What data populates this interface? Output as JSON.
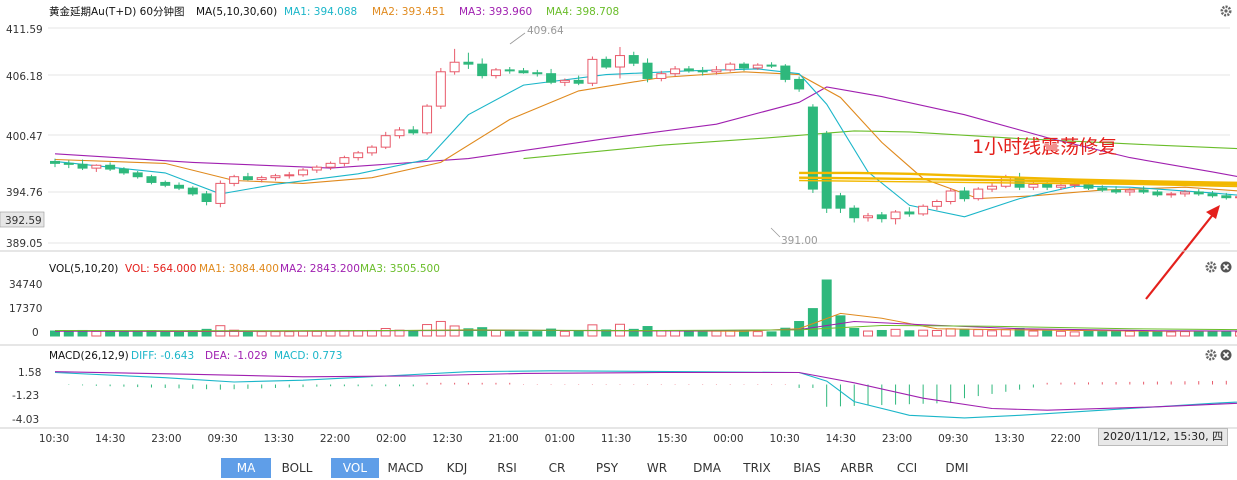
{
  "colors": {
    "up": "#e85a6a",
    "down": "#2eb87c",
    "ma1": "#1bb6c9",
    "ma2": "#e08a1e",
    "ma3": "#a020b0",
    "ma4": "#6abd2a",
    "annot": "#e4201c",
    "yellow": "#f2b800"
  },
  "main_panel": {
    "title": "黄金延期Au(T+D) 60分钟图",
    "ma_label": "MA(5,10,30,60)",
    "ma1_label": "MA1: 394.088",
    "ma2_label": "MA2: 393.451",
    "ma3_label": "MA3: 393.960",
    "ma4_label": "MA4: 398.708",
    "y_ticks": [
      "411.59",
      "406.18",
      "400.47",
      "394.76",
      "389.05"
    ],
    "current_price": "392.59",
    "high_label": "409.64",
    "low_label": "391.00",
    "annotation": "1小时线震荡修复"
  },
  "vol_panel": {
    "label": "VOL(5,10,20)",
    "vol_label": "VOL: 564.000",
    "ma1_label": "MA1: 3084.400",
    "ma2_label": "MA2: 2843.200",
    "ma3_label": "MA3: 3505.500",
    "y_ticks": [
      "34740",
      "17370",
      "0"
    ]
  },
  "macd_panel": {
    "label": "MACD(26,12,9)",
    "diff_label": "DIFF: -0.643",
    "dea_label": "DEA: -1.029",
    "macd_label": "MACD: 0.773",
    "y_ticks": [
      "1.58",
      "-1.23",
      "-4.03"
    ]
  },
  "x_ticks": [
    "10:30",
    "14:30",
    "23:00",
    "09:30",
    "13:30",
    "22:00",
    "02:00",
    "12:30",
    "21:00",
    "01:00",
    "11:30",
    "15:30",
    "00:00",
    "10:30",
    "14:30",
    "23:00",
    "09:30",
    "13:30",
    "22:00"
  ],
  "crosshair_time": "2020/11/12, 15:30, 四",
  "tabs": [
    "MA",
    "BOLL",
    "VOL",
    "MACD",
    "KDJ",
    "RSI",
    "CR",
    "PSY",
    "WR",
    "DMA",
    "TRIX",
    "BIAS",
    "ARBR",
    "CCI",
    "DMI"
  ],
  "active_tabs": [
    "MA",
    "VOL"
  ],
  "icons": {
    "settings": "gear-icon",
    "close": "close-icon"
  },
  "chart_data": {
    "type": "candlestick",
    "title": "黄金延期Au(T+D) 60分钟图",
    "ylim": [
      389.05,
      411.59
    ],
    "candles": [
      [
        397.6,
        397.9,
        397.0,
        397.4
      ],
      [
        397.4,
        397.7,
        396.9,
        397.3
      ],
      [
        397.3,
        397.8,
        396.7,
        396.9
      ],
      [
        396.9,
        397.3,
        396.5,
        397.2
      ],
      [
        397.2,
        397.5,
        396.6,
        396.8
      ],
      [
        396.8,
        397.0,
        396.2,
        396.4
      ],
      [
        396.4,
        396.6,
        395.8,
        396.0
      ],
      [
        396.0,
        396.2,
        395.2,
        395.4
      ],
      [
        395.4,
        395.6,
        394.9,
        395.1
      ],
      [
        395.1,
        395.4,
        394.6,
        394.8
      ],
      [
        394.8,
        395.0,
        394.0,
        394.2
      ],
      [
        394.2,
        394.5,
        393.0,
        393.4
      ],
      [
        393.2,
        395.6,
        392.8,
        395.3
      ],
      [
        395.3,
        396.2,
        395.0,
        396.0
      ],
      [
        396.0,
        396.4,
        395.6,
        395.7
      ],
      [
        395.7,
        396.1,
        395.4,
        395.9
      ],
      [
        395.9,
        396.3,
        395.6,
        396.1
      ],
      [
        396.1,
        396.5,
        395.8,
        396.2
      ],
      [
        396.2,
        396.9,
        396.0,
        396.7
      ],
      [
        396.7,
        397.2,
        396.4,
        397.0
      ],
      [
        397.0,
        397.6,
        396.7,
        397.4
      ],
      [
        397.4,
        398.2,
        397.1,
        398.0
      ],
      [
        398.0,
        398.7,
        397.7,
        398.5
      ],
      [
        398.5,
        399.3,
        398.2,
        399.1
      ],
      [
        399.1,
        400.7,
        398.9,
        400.3
      ],
      [
        400.3,
        401.2,
        400.0,
        400.9
      ],
      [
        400.9,
        401.3,
        400.4,
        400.6
      ],
      [
        400.6,
        403.6,
        400.4,
        403.4
      ],
      [
        403.4,
        407.4,
        403.1,
        407.0
      ],
      [
        407.0,
        409.4,
        406.7,
        408.0
      ],
      [
        408.0,
        409.0,
        407.3,
        407.8
      ],
      [
        407.8,
        408.4,
        406.3,
        406.6
      ],
      [
        406.6,
        407.4,
        406.3,
        407.2
      ],
      [
        407.2,
        407.5,
        406.8,
        407.1
      ],
      [
        407.1,
        407.4,
        406.8,
        406.9
      ],
      [
        406.9,
        407.2,
        406.5,
        406.8
      ],
      [
        406.8,
        407.3,
        405.7,
        405.9
      ],
      [
        405.9,
        406.3,
        405.5,
        406.1
      ],
      [
        406.1,
        406.6,
        405.6,
        405.8
      ],
      [
        405.8,
        408.6,
        405.5,
        408.3
      ],
      [
        408.3,
        408.6,
        407.3,
        407.5
      ],
      [
        407.5,
        409.6,
        406.3,
        408.7
      ],
      [
        408.7,
        409.1,
        407.6,
        407.9
      ],
      [
        407.9,
        408.4,
        405.9,
        406.3
      ],
      [
        406.3,
        407.1,
        406.0,
        406.8
      ],
      [
        406.8,
        407.6,
        406.5,
        407.3
      ],
      [
        407.3,
        407.6,
        406.9,
        407.1
      ],
      [
        407.1,
        407.5,
        406.6,
        407.0
      ],
      [
        407.0,
        407.6,
        406.7,
        407.2
      ],
      [
        407.2,
        408.0,
        407.0,
        407.8
      ],
      [
        407.8,
        408.0,
        407.1,
        407.4
      ],
      [
        407.4,
        407.9,
        407.2,
        407.7
      ],
      [
        407.7,
        408.0,
        407.4,
        407.6
      ],
      [
        407.6,
        407.8,
        405.9,
        406.2
      ],
      [
        406.2,
        406.5,
        404.9,
        405.2
      ],
      [
        403.3,
        403.6,
        394.3,
        394.7
      ],
      [
        400.5,
        400.8,
        392.2,
        392.7
      ],
      [
        394.0,
        394.3,
        392.2,
        392.7
      ],
      [
        392.7,
        393.0,
        391.2,
        391.7
      ],
      [
        391.7,
        392.2,
        391.3,
        391.9
      ],
      [
        392.0,
        392.3,
        391.2,
        391.6
      ],
      [
        391.6,
        392.5,
        391.0,
        392.3
      ],
      [
        392.3,
        392.8,
        391.8,
        392.1
      ],
      [
        392.1,
        393.1,
        391.9,
        392.9
      ],
      [
        392.9,
        393.6,
        392.5,
        393.4
      ],
      [
        393.4,
        394.8,
        393.1,
        394.5
      ],
      [
        394.5,
        394.9,
        393.4,
        393.7
      ],
      [
        393.7,
        394.9,
        393.5,
        394.7
      ],
      [
        394.7,
        395.4,
        394.4,
        395.0
      ],
      [
        395.0,
        396.2,
        394.8,
        395.9
      ],
      [
        395.9,
        396.4,
        394.6,
        394.9
      ],
      [
        394.9,
        395.5,
        394.6,
        395.2
      ],
      [
        395.2,
        395.5,
        394.6,
        394.9
      ],
      [
        394.9,
        395.4,
        394.6,
        395.1
      ],
      [
        395.1,
        395.4,
        394.8,
        395.2
      ],
      [
        395.2,
        395.5,
        394.6,
        394.8
      ],
      [
        394.8,
        395.1,
        394.4,
        394.6
      ],
      [
        394.6,
        395.0,
        394.2,
        394.4
      ],
      [
        394.4,
        394.8,
        394.0,
        394.6
      ],
      [
        394.6,
        395.0,
        394.2,
        394.4
      ],
      [
        394.4,
        394.6,
        393.9,
        394.1
      ],
      [
        394.1,
        394.4,
        393.8,
        394.2
      ],
      [
        394.2,
        394.6,
        393.9,
        394.4
      ],
      [
        394.4,
        394.7,
        394.0,
        394.2
      ],
      [
        394.2,
        394.5,
        393.8,
        394.0
      ],
      [
        394.0,
        394.3,
        393.6,
        393.8
      ],
      [
        393.8,
        394.1,
        393.5,
        393.9
      ],
      [
        393.9,
        394.5,
        393.4,
        394.3
      ],
      [
        394.3,
        394.6,
        393.8,
        393.9
      ],
      [
        393.9,
        394.1,
        391.9,
        392.2
      ],
      [
        392.2,
        394.1,
        391.6,
        393.4
      ],
      [
        393.4,
        393.6,
        392.5,
        392.7
      ],
      [
        392.7,
        393.2,
        392.4,
        392.9
      ],
      [
        392.9,
        393.3,
        392.5,
        392.7
      ],
      [
        392.7,
        393.4,
        392.4,
        393.2
      ],
      [
        393.2,
        394.0,
        393.0,
        393.7
      ],
      [
        393.7,
        394.0,
        393.4,
        393.8
      ],
      [
        393.8,
        394.2,
        393.5,
        393.9
      ],
      [
        393.9,
        394.3,
        393.6,
        394.0
      ],
      [
        394.0,
        394.3,
        393.6,
        393.8
      ],
      [
        393.8,
        394.2,
        393.5,
        394.0
      ],
      [
        394.0,
        394.3,
        393.6,
        393.9
      ],
      [
        393.9,
        394.3,
        393.6,
        394.1
      ],
      [
        394.1,
        394.3,
        393.8,
        393.9
      ],
      [
        393.9,
        394.0,
        392.4,
        392.59
      ]
    ],
    "ma1": [
      [
        0,
        397.6
      ],
      [
        8,
        396.4
      ],
      [
        12,
        394.2
      ],
      [
        16,
        395.2
      ],
      [
        22,
        396.3
      ],
      [
        27,
        397.8
      ],
      [
        30,
        402.5
      ],
      [
        34,
        405.6
      ],
      [
        40,
        406.7
      ],
      [
        46,
        407.1
      ],
      [
        51,
        407.3
      ],
      [
        54,
        406.8
      ],
      [
        56,
        403.6
      ],
      [
        59,
        396.5
      ],
      [
        62,
        393.0
      ],
      [
        66,
        391.8
      ],
      [
        70,
        393.7
      ],
      [
        74,
        395.0
      ],
      [
        78,
        394.9
      ],
      [
        84,
        394.3
      ],
      [
        88,
        393.8
      ],
      [
        92,
        393.3
      ],
      [
        96,
        393.0
      ],
      [
        101,
        393.7
      ],
      [
        104,
        394.1
      ]
    ],
    "ma2": [
      [
        0,
        397.8
      ],
      [
        8,
        397.4
      ],
      [
        13,
        395.6
      ],
      [
        18,
        395.3
      ],
      [
        23,
        395.9
      ],
      [
        28,
        397.5
      ],
      [
        33,
        402.0
      ],
      [
        38,
        405.0
      ],
      [
        44,
        406.4
      ],
      [
        50,
        407.0
      ],
      [
        54,
        406.7
      ],
      [
        57,
        404.3
      ],
      [
        60,
        399.6
      ],
      [
        63,
        395.8
      ],
      [
        67,
        393.7
      ],
      [
        71,
        394.0
      ],
      [
        76,
        394.6
      ],
      [
        82,
        394.9
      ],
      [
        88,
        394.3
      ],
      [
        94,
        393.6
      ],
      [
        98,
        393.4
      ],
      [
        101,
        393.6
      ],
      [
        104,
        394.0
      ]
    ],
    "ma3": [
      [
        0,
        398.4
      ],
      [
        10,
        397.5
      ],
      [
        20,
        396.9
      ],
      [
        30,
        397.9
      ],
      [
        40,
        400.0
      ],
      [
        48,
        401.5
      ],
      [
        54,
        403.8
      ],
      [
        56,
        405.4
      ],
      [
        60,
        404.4
      ],
      [
        66,
        402.5
      ],
      [
        72,
        400.1
      ],
      [
        78,
        398.0
      ],
      [
        84,
        396.5
      ],
      [
        90,
        394.9
      ],
      [
        96,
        394.4
      ],
      [
        101,
        394.0
      ],
      [
        104,
        393.96
      ]
    ],
    "ma4": [
      [
        34,
        397.9
      ],
      [
        44,
        399.3
      ],
      [
        52,
        400.1
      ],
      [
        58,
        400.8
      ],
      [
        62,
        400.7
      ],
      [
        70,
        400.0
      ],
      [
        80,
        399.3
      ],
      [
        90,
        398.7
      ],
      [
        98,
        398.4
      ],
      [
        104,
        397.3
      ]
    ],
    "volume": {
      "ylim": [
        0,
        34740
      ],
      "ma1": 3084.4,
      "ma2": 2843.2,
      "ma3": 3505.5,
      "last": 564
    },
    "macd": {
      "ylim": [
        -4.03,
        1.58
      ],
      "diff": -0.643,
      "dea": -1.029,
      "macd": 0.773
    }
  }
}
